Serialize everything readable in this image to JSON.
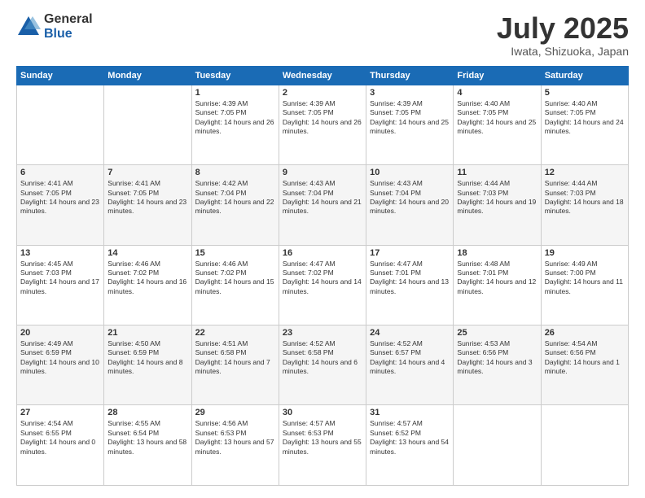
{
  "header": {
    "logo_general": "General",
    "logo_blue": "Blue",
    "title": "July 2025",
    "location": "Iwata, Shizuoka, Japan"
  },
  "days_of_week": [
    "Sunday",
    "Monday",
    "Tuesday",
    "Wednesday",
    "Thursday",
    "Friday",
    "Saturday"
  ],
  "weeks": [
    [
      {
        "day": "",
        "info": ""
      },
      {
        "day": "",
        "info": ""
      },
      {
        "day": "1",
        "info": "Sunrise: 4:39 AM\nSunset: 7:05 PM\nDaylight: 14 hours and 26 minutes."
      },
      {
        "day": "2",
        "info": "Sunrise: 4:39 AM\nSunset: 7:05 PM\nDaylight: 14 hours and 26 minutes."
      },
      {
        "day": "3",
        "info": "Sunrise: 4:39 AM\nSunset: 7:05 PM\nDaylight: 14 hours and 25 minutes."
      },
      {
        "day": "4",
        "info": "Sunrise: 4:40 AM\nSunset: 7:05 PM\nDaylight: 14 hours and 25 minutes."
      },
      {
        "day": "5",
        "info": "Sunrise: 4:40 AM\nSunset: 7:05 PM\nDaylight: 14 hours and 24 minutes."
      }
    ],
    [
      {
        "day": "6",
        "info": "Sunrise: 4:41 AM\nSunset: 7:05 PM\nDaylight: 14 hours and 23 minutes."
      },
      {
        "day": "7",
        "info": "Sunrise: 4:41 AM\nSunset: 7:05 PM\nDaylight: 14 hours and 23 minutes."
      },
      {
        "day": "8",
        "info": "Sunrise: 4:42 AM\nSunset: 7:04 PM\nDaylight: 14 hours and 22 minutes."
      },
      {
        "day": "9",
        "info": "Sunrise: 4:43 AM\nSunset: 7:04 PM\nDaylight: 14 hours and 21 minutes."
      },
      {
        "day": "10",
        "info": "Sunrise: 4:43 AM\nSunset: 7:04 PM\nDaylight: 14 hours and 20 minutes."
      },
      {
        "day": "11",
        "info": "Sunrise: 4:44 AM\nSunset: 7:03 PM\nDaylight: 14 hours and 19 minutes."
      },
      {
        "day": "12",
        "info": "Sunrise: 4:44 AM\nSunset: 7:03 PM\nDaylight: 14 hours and 18 minutes."
      }
    ],
    [
      {
        "day": "13",
        "info": "Sunrise: 4:45 AM\nSunset: 7:03 PM\nDaylight: 14 hours and 17 minutes."
      },
      {
        "day": "14",
        "info": "Sunrise: 4:46 AM\nSunset: 7:02 PM\nDaylight: 14 hours and 16 minutes."
      },
      {
        "day": "15",
        "info": "Sunrise: 4:46 AM\nSunset: 7:02 PM\nDaylight: 14 hours and 15 minutes."
      },
      {
        "day": "16",
        "info": "Sunrise: 4:47 AM\nSunset: 7:02 PM\nDaylight: 14 hours and 14 minutes."
      },
      {
        "day": "17",
        "info": "Sunrise: 4:47 AM\nSunset: 7:01 PM\nDaylight: 14 hours and 13 minutes."
      },
      {
        "day": "18",
        "info": "Sunrise: 4:48 AM\nSunset: 7:01 PM\nDaylight: 14 hours and 12 minutes."
      },
      {
        "day": "19",
        "info": "Sunrise: 4:49 AM\nSunset: 7:00 PM\nDaylight: 14 hours and 11 minutes."
      }
    ],
    [
      {
        "day": "20",
        "info": "Sunrise: 4:49 AM\nSunset: 6:59 PM\nDaylight: 14 hours and 10 minutes."
      },
      {
        "day": "21",
        "info": "Sunrise: 4:50 AM\nSunset: 6:59 PM\nDaylight: 14 hours and 8 minutes."
      },
      {
        "day": "22",
        "info": "Sunrise: 4:51 AM\nSunset: 6:58 PM\nDaylight: 14 hours and 7 minutes."
      },
      {
        "day": "23",
        "info": "Sunrise: 4:52 AM\nSunset: 6:58 PM\nDaylight: 14 hours and 6 minutes."
      },
      {
        "day": "24",
        "info": "Sunrise: 4:52 AM\nSunset: 6:57 PM\nDaylight: 14 hours and 4 minutes."
      },
      {
        "day": "25",
        "info": "Sunrise: 4:53 AM\nSunset: 6:56 PM\nDaylight: 14 hours and 3 minutes."
      },
      {
        "day": "26",
        "info": "Sunrise: 4:54 AM\nSunset: 6:56 PM\nDaylight: 14 hours and 1 minute."
      }
    ],
    [
      {
        "day": "27",
        "info": "Sunrise: 4:54 AM\nSunset: 6:55 PM\nDaylight: 14 hours and 0 minutes."
      },
      {
        "day": "28",
        "info": "Sunrise: 4:55 AM\nSunset: 6:54 PM\nDaylight: 13 hours and 58 minutes."
      },
      {
        "day": "29",
        "info": "Sunrise: 4:56 AM\nSunset: 6:53 PM\nDaylight: 13 hours and 57 minutes."
      },
      {
        "day": "30",
        "info": "Sunrise: 4:57 AM\nSunset: 6:53 PM\nDaylight: 13 hours and 55 minutes."
      },
      {
        "day": "31",
        "info": "Sunrise: 4:57 AM\nSunset: 6:52 PM\nDaylight: 13 hours and 54 minutes."
      },
      {
        "day": "",
        "info": ""
      },
      {
        "day": "",
        "info": ""
      }
    ]
  ]
}
